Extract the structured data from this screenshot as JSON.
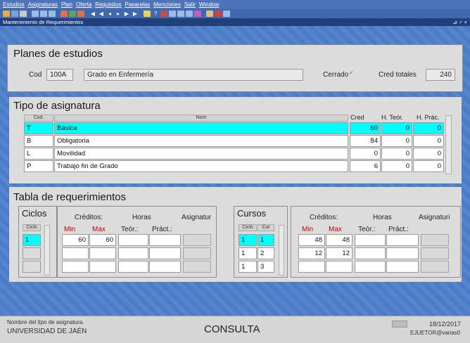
{
  "menu": [
    "Estudios",
    "Asignaturas",
    "Plan",
    "Oferta",
    "Requisitos",
    "Pasarelas",
    "Menciones",
    "Salir",
    "Window"
  ],
  "window_title": "Mantenimiento de Requerimientos",
  "window_controls": "⊿ ♂ ×",
  "planes": {
    "title": "Planes de estudios",
    "cod_label": "Cod",
    "cod_value": "100A",
    "name_value": "Grado en Enfermería",
    "cerrado_label": "Cerrado",
    "cerrado_mark": "✓",
    "cred_label": "Cred totales",
    "cred_value": "240"
  },
  "tipo": {
    "title": "Tipo de asignatura",
    "headers": {
      "cod": "Cod.",
      "nom": "Nom",
      "cred": "Cred",
      "teor": "H. Teór.",
      "pract": "H. Prác."
    },
    "rows": [
      {
        "cod": "T",
        "nom": "Básica",
        "cred": "60",
        "teor": "0",
        "pract": "0"
      },
      {
        "cod": "B",
        "nom": "Obligatoria",
        "cred": "84",
        "teor": "0",
        "pract": "0"
      },
      {
        "cod": "L",
        "nom": "Movilidad",
        "cred": "0",
        "teor": "0",
        "pract": "0"
      },
      {
        "cod": "P",
        "nom": "Trabajo fin de Grado",
        "cred": "6",
        "teor": "0",
        "pract": "0"
      }
    ]
  },
  "req": {
    "title": "Tabla de requerimientos",
    "ciclos": {
      "title": "Ciclos",
      "col": "Ciclo",
      "creditos": "Créditos:",
      "horas": "Horas",
      "asignat": "Asignatur",
      "min": "Min",
      "max": "Max",
      "teor": "Teór.:",
      "pract": "Práct.:",
      "rows": [
        {
          "ciclo": "1",
          "min": "60",
          "max": "60"
        }
      ]
    },
    "cursos": {
      "title": "Cursos",
      "col_ciclo": "Ciclo",
      "col_cur": "Cur",
      "creditos": "Créditos:",
      "horas": "Horas",
      "asignat": "Asignaturi",
      "min": "Min",
      "max": "Max",
      "teor": "Teór.:",
      "pract": "Práct.:",
      "rows": [
        {
          "ciclo": "1",
          "cur": "1",
          "min": "48",
          "max": "48"
        },
        {
          "ciclo": "1",
          "cur": "2",
          "min": "12",
          "max": "12"
        },
        {
          "ciclo": "1",
          "cur": "3",
          "min": "",
          "max": ""
        }
      ]
    }
  },
  "status": {
    "hint": "Nombre del tipo de asignatura.",
    "org": "UNIVERSIDAD DE JAÉN",
    "mode": "CONSULTA",
    "date": "18/12/2017",
    "user": "EJUETOR@varias0"
  }
}
